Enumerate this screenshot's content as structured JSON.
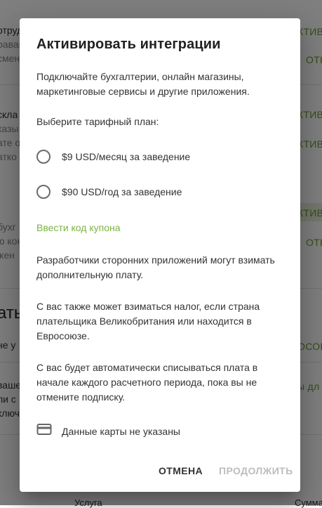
{
  "background": {
    "fragments_left": [
      "отруд",
      "равав",
      "смен",
      "скла",
      "казы",
      "ате о",
      "атко",
      "бухг",
      "ю кон",
      "жен",
      "ать",
      "не у",
      "ваше",
      "ли с",
      "ключ"
    ],
    "fragments_right": [
      "КТИВ",
      "ОТК",
      "КТИВ",
      "КТИВ",
      "КТИВ",
      "ОТК",
      "КТИВ",
      "ОСОВ",
      "ы дл"
    ],
    "footer_left": "Услуга",
    "footer_right": "Сумма"
  },
  "dialog": {
    "title": "Активировать интеграции",
    "intro": "Подключайте бухгалтерии, онлайн магазины, маркетинговые сервисы и другие приложения.",
    "plan_prompt": "Выберите тарифный план:",
    "plans": [
      {
        "label": "$9 USD/месяц за заведение",
        "selected": false
      },
      {
        "label": "$90 USD/год за заведение",
        "selected": false
      }
    ],
    "coupon_link": "Ввести код купона",
    "notice_fees": "Разработчики сторонних приложений могут взимать дополнительную плату.",
    "notice_tax": "С вас также может взиматься налог, если страна плательщика Великобритания или находится в Евросоюзе.",
    "notice_billing": "С вас будет автоматически списываться плата в начале каждого расчетного периода, пока вы не отмените подписку.",
    "card_status": "Данные карты не указаны",
    "card_icon": "credit-card-icon",
    "cancel_label": "ОТМЕНА",
    "continue_label": "ПРОДОЛЖИТЬ"
  },
  "colors": {
    "accent": "#7cb342",
    "disabled": "#bdbdbd",
    "text": "#333333"
  }
}
